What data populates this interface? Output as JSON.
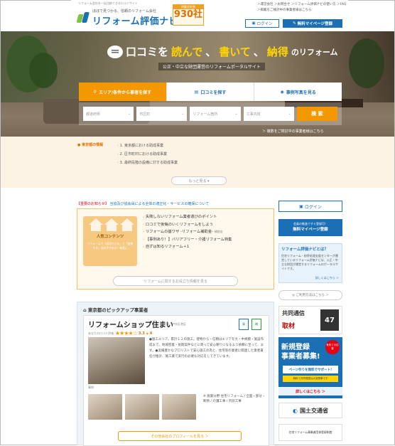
{
  "header": {
    "tagline": "リフォーム会社を一括比較できる口コミサイト",
    "logo_sub": "ほぼで見つかる、信頼のリフォーム会社",
    "logo_name": "リフォーム評価ナビ",
    "count_label": "掲載会社数",
    "count_value": "930社",
    "count_unit": "",
    "links": [
      "＞運営会社 ＞お問合せ ＞リフォーム評価ナビの使い方 ＞FAQ",
      "＞掲載をご検討中の事業者様はこちら"
    ],
    "login_label": "ログイン",
    "register_label": "無料マイページ登録"
  },
  "hero": {
    "title_pre": "口コミを",
    "title_w1": "読んで",
    "title_sep1": "、",
    "title_w2": "書いて",
    "title_sep2": "、",
    "title_w3": "納得",
    "title_post": "のリフォーム",
    "tagline": "公正・中立な財団運営のリフォームポータルサイト",
    "tabs": [
      {
        "label": "エリア/条件から事者を探す"
      },
      {
        "label": "口コミを探す"
      },
      {
        "label": "事例写真を見る"
      }
    ],
    "selects": [
      "都道府県",
      "市区町",
      "リフォーム箇所",
      "工事内容"
    ],
    "search_label": "検 索",
    "note": "＞ 複数をご検討中の事業者様はこちら"
  },
  "area": {
    "label": "東京都の情報",
    "items": [
      "1. 東京都における助成事業",
      "2. 区市町村における助成事業",
      "3. 最終段階の設備に対する助成事業"
    ],
    "more": "もっと見る ▾"
  },
  "main": {
    "notice_red": "【重要のお知らせ】",
    "notice_blue": "当協及び協会員による全体の適正化・サービスの確保について",
    "content": {
      "pic_title": "人気コンテンツ",
      "pic_desc": "リフォームで「成功させる」と「後悔する」決め手がある！確実に",
      "items": [
        {
          "text": "失敗しないリフォーム業者選びのポイント",
          "tag": ""
        },
        {
          "text": "口コミで後悔のいくリフォームをしよう",
          "tag": ""
        },
        {
          "text": "リフォームの基ワザ ‐リフォーム補助金‐",
          "tag": "補助金"
        },
        {
          "text": "【事例あり！】バリアフリー・介護リフォーム特集",
          "tag": ""
        },
        {
          "text": "自ずは知るリフォーム＋1",
          "tag": ""
        }
      ],
      "more": "リフォームに関するお役立ち情報を見る"
    },
    "pickup": {
      "heading": "東京都のピックアップ事業者",
      "name": "リフォームショップ住まい",
      "name_sub": "港区所・中央区港区",
      "rating_label": "あなたの口コミ評価",
      "stars": "★★★★☆",
      "score": "3.3",
      "count": "4",
      "icons": [
        "資",
        "補"
      ],
      "desc": "●施工エリア、累計１２の施工。建物から・信頼はエリアを大・中規模・施設作成まで。地域密着・長期案件などに寄って安心頼りになるよう依頼に至って、ます。●実績豊かなプロリストで安心施工の為と、住宅等の業者に関連した業者責任が推計、施工業で実行の必要な対応をしてきています。",
      "photo_caption": "事例",
      "meta": "※ 施業分野  住宅リフォーム / 全面・部分・断熱 / 介護工事 / 内装工事",
      "profile": "その他会社のプロフィールを見る ＞"
    }
  },
  "side": {
    "login": "ログイン",
    "reg_note": "会員の推進ですぐ登録可！",
    "reg_label": "無料マイページ登録",
    "what_title": "リフォーム評価ナビとは？",
    "what_body": "住宅リフォーム・紛争処理支援センターが運営しているリフォーム評価ナビは、公正・中立な財団が運営するリフォームのポータルサイトです。",
    "what_link": "詳しくはこちら ＞",
    "usage": "ご利用方法はこちら ＞",
    "ad1_a": "共同通信",
    "ad1_b": "取材",
    "ad1_num": "47",
    "ad2_title": "新規登録\n事業者募集!",
    "ad2_badge": "有料での応募",
    "ad2_white": "ページ作りを無料でサポート!",
    "ad2_yellow": "無料で共同運営は大変簡単です",
    "ad2_cta": "詳しくはこちら ＞",
    "ad3": "国土交通省",
    "ad4": "住宅リフォーム事業者団体登録制度"
  },
  "colors": {
    "accent": "#f39800",
    "brand": "#1a6fb5",
    "alert": "#e60012"
  }
}
